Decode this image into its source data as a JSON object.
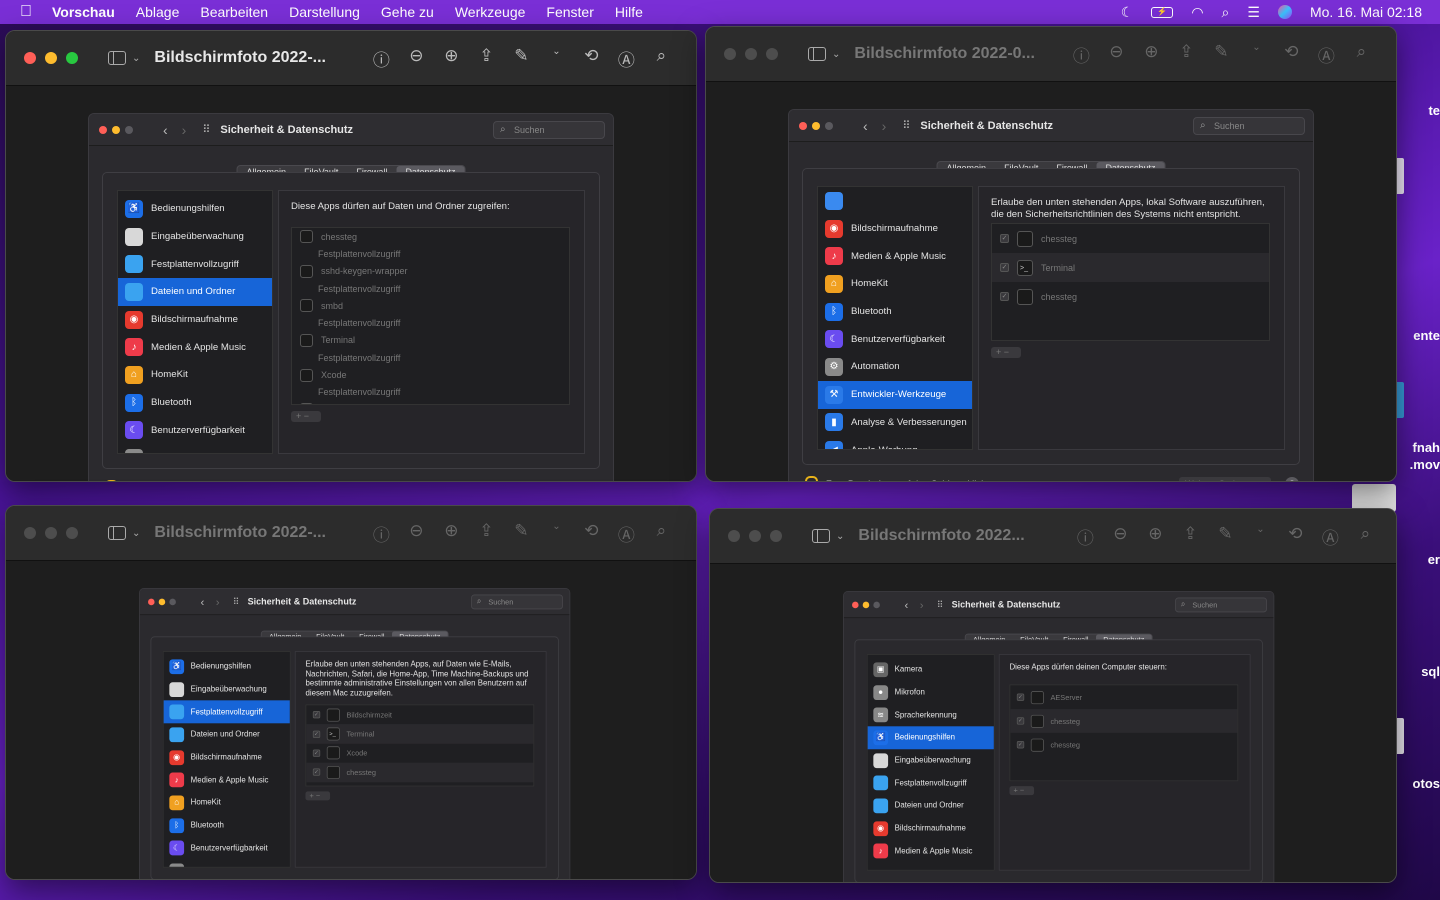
{
  "menubar": {
    "apple": "",
    "app": "Vorschau",
    "items": [
      "Ablage",
      "Bearbeiten",
      "Darstellung",
      "Gehe zu",
      "Werkzeuge",
      "Fenster",
      "Hilfe"
    ],
    "clock": "Mo. 16. Mai  02:18"
  },
  "desktop": {
    "labels": [
      "te",
      "ente",
      "fnah",
      ".mov",
      "er",
      "sql",
      "otos"
    ]
  },
  "windows": [
    {
      "title": "Bildschirmfoto 2022-...",
      "active": true
    },
    {
      "title": "Bildschirmfoto 2022-0...",
      "active": false
    },
    {
      "title": "Bildschirmfoto 2022-...",
      "active": false
    },
    {
      "title": "Bildschirmfoto 2022...",
      "active": false
    }
  ],
  "prefs": {
    "title": "Sicherheit & Datenschutz",
    "search": "Suchen",
    "tabs": [
      "Allgemein",
      "FileVault",
      "Firewall",
      "Datenschutz"
    ],
    "lock_text": "Zum Bearbeiten auf das Schloss klicken.",
    "more_options": "Weitere Optionen ...",
    "help": "?",
    "plusminus": "+ −"
  },
  "shots": [
    {
      "sidebar": [
        {
          "label": "Bedienungshilfen",
          "icon": "accessibility-icon"
        },
        {
          "label": "Eingabeüberwachung",
          "icon": "keyboard-icon"
        },
        {
          "label": "Festplattenvollzugriff",
          "icon": "folder-icon"
        },
        {
          "label": "Dateien und Ordner",
          "icon": "folder-icon",
          "selected": true
        },
        {
          "label": "Bildschirmaufnahme",
          "icon": "screen-record-icon"
        },
        {
          "label": "Medien & Apple Music",
          "icon": "music-icon"
        },
        {
          "label": "HomeKit",
          "icon": "home-icon"
        },
        {
          "label": "Bluetooth",
          "icon": "bluetooth-icon"
        },
        {
          "label": "Benutzerverfügbarkeit",
          "icon": "moon-icon"
        },
        {
          "label": "Automation",
          "icon": "gear-icon"
        }
      ],
      "header": "Diese Apps dürfen auf Daten und Ordner zugreifen:",
      "list": [
        "chessteg",
        "Festplattenvollzugriff",
        "sshd-keygen-wrapper",
        "Festplattenvollzugriff",
        "smbd",
        "Festplattenvollzugriff",
        "Terminal",
        "Festplattenvollzugriff",
        "Xcode",
        "Festplattenvollzugriff",
        "chessteg"
      ]
    },
    {
      "sidebar": [
        {
          "label": "",
          "icon": "blank-icon"
        },
        {
          "label": "Bildschirmaufnahme",
          "icon": "screen-record-icon"
        },
        {
          "label": "Medien & Apple Music",
          "icon": "music-icon"
        },
        {
          "label": "HomeKit",
          "icon": "home-icon"
        },
        {
          "label": "Bluetooth",
          "icon": "bluetooth-icon"
        },
        {
          "label": "Benutzerverfügbarkeit",
          "icon": "moon-icon"
        },
        {
          "label": "Automation",
          "icon": "gear-icon"
        },
        {
          "label": "Entwickler-Werkzeuge",
          "icon": "dev-tools-icon",
          "selected": true
        },
        {
          "label": "Analyse & Verbesserungen",
          "icon": "analytics-icon"
        },
        {
          "label": "Apple-Werbung",
          "icon": "megaphone-icon"
        }
      ],
      "header": "Erlaube den unten stehenden Apps, lokal Software auszuführen, die den Sicherheitsrichtlinien des Systems nicht entspricht.",
      "list": [
        "chessteg",
        "Terminal",
        "chessteg"
      ]
    },
    {
      "sidebar": [
        {
          "label": "Bedienungshilfen",
          "icon": "accessibility-icon"
        },
        {
          "label": "Eingabeüberwachung",
          "icon": "keyboard-icon"
        },
        {
          "label": "Festplattenvollzugriff",
          "icon": "folder-icon",
          "selected": true
        },
        {
          "label": "Dateien und Ordner",
          "icon": "folder-icon"
        },
        {
          "label": "Bildschirmaufnahme",
          "icon": "screen-record-icon"
        },
        {
          "label": "Medien & Apple Music",
          "icon": "music-icon"
        },
        {
          "label": "HomeKit",
          "icon": "home-icon"
        },
        {
          "label": "Bluetooth",
          "icon": "bluetooth-icon"
        },
        {
          "label": "Benutzerverfügbarkeit",
          "icon": "moon-icon"
        },
        {
          "label": "Automation",
          "icon": "gear-icon"
        }
      ],
      "header": "Erlaube den unten stehenden Apps, auf Daten wie E-Mails, Nachrichten, Safari, die Home-App, Time Machine-Backups und bestimmte administrative Einstellungen von allen Benutzern auf diesem Mac zuzugreifen.",
      "list": [
        "Bildschirmzeit",
        "Terminal",
        "Xcode",
        "chessteg"
      ]
    },
    {
      "sidebar": [
        {
          "label": "Kamera",
          "icon": "camera-icon"
        },
        {
          "label": "Mikrofon",
          "icon": "microphone-icon"
        },
        {
          "label": "Spracherkennung",
          "icon": "waveform-icon"
        },
        {
          "label": "Bedienungshilfen",
          "icon": "accessibility-icon",
          "selected": true
        },
        {
          "label": "Eingabeüberwachung",
          "icon": "keyboard-icon"
        },
        {
          "label": "Festplattenvollzugriff",
          "icon": "folder-icon"
        },
        {
          "label": "Dateien und Ordner",
          "icon": "folder-icon"
        },
        {
          "label": "Bildschirmaufnahme",
          "icon": "screen-record-icon"
        },
        {
          "label": "Medien & Apple Music",
          "icon": "music-icon"
        }
      ],
      "header": "Diese Apps dürfen deinen Computer steuern:",
      "list": [
        "AEServer",
        "chessteg",
        "chessteg"
      ]
    }
  ],
  "colors": {
    "accent": "#1765d8",
    "menubar": "#7a2fd6",
    "lock": "#e8b21a"
  }
}
